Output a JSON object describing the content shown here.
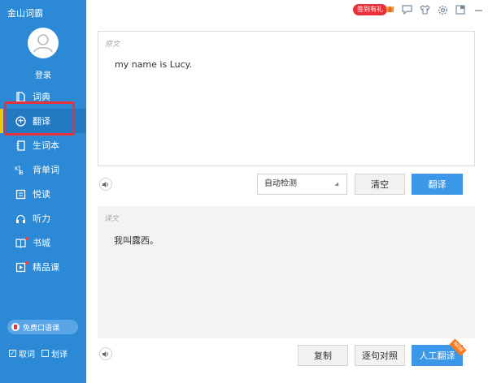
{
  "sidebar": {
    "app_title": "金山词霸",
    "login_label": "登录",
    "items": [
      {
        "label": "词典",
        "icon": "book-icon"
      },
      {
        "label": "翻译",
        "icon": "translate-icon",
        "active": true
      },
      {
        "label": "生词本",
        "icon": "notebook-icon"
      },
      {
        "label": "背单词",
        "icon": "flashcard-icon"
      },
      {
        "label": "悦读",
        "icon": "reading-icon"
      },
      {
        "label": "听力",
        "icon": "headphones-icon"
      },
      {
        "label": "书城",
        "icon": "bookstore-icon"
      },
      {
        "label": "精品课",
        "icon": "video-course-icon"
      }
    ],
    "promo_label": "免费口语课",
    "checks": [
      {
        "label": "取词",
        "checked": true
      },
      {
        "label": "划译",
        "checked": false
      }
    ]
  },
  "topbar": {
    "signin_badge": "签到有礼",
    "icons": [
      "gift-icon",
      "chat-icon",
      "skin-icon",
      "settings-icon",
      "minimize-to-tray-icon",
      "minimize-icon",
      "close-icon"
    ]
  },
  "source": {
    "label": "原文",
    "text": "my name is Lucy."
  },
  "controls": {
    "language_value": "自动检测",
    "clear_label": "清空",
    "translate_label": "翻译"
  },
  "target": {
    "label": "译文",
    "text": "我叫露西。"
  },
  "bottom_actions": {
    "copy_label": "复制",
    "compare_label": "逐句对照",
    "human_translate_label": "人工翻译",
    "new_tag": "NEW"
  },
  "colors": {
    "sidebar_bg": "#2b89d6",
    "accent_blue": "#3b97e8",
    "active_marker": "#f5c400",
    "highlight_red": "#e8313b",
    "new_tag_orange": "#ff7a1a"
  }
}
